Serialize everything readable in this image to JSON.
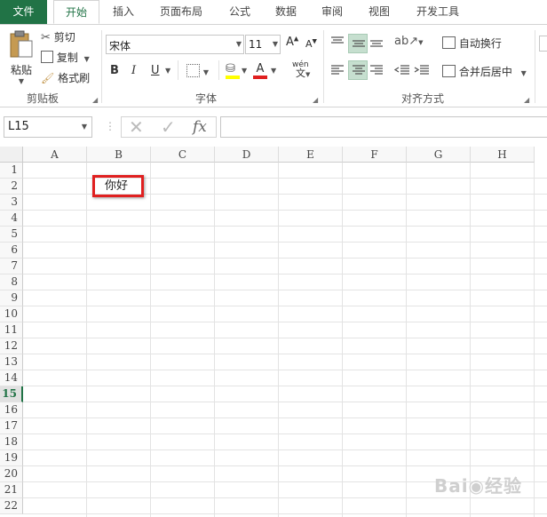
{
  "tabs": [
    "文件",
    "开始",
    "插入",
    "页面布局",
    "公式",
    "数据",
    "审阅",
    "视图",
    "开发工具"
  ],
  "clipboard": {
    "paste": "粘贴",
    "cut": "剪切",
    "copy": "复制",
    "format_painter": "格式刷",
    "group": "剪贴板"
  },
  "font": {
    "name": "宋体",
    "size": "11",
    "bold": "B",
    "italic": "I",
    "underline": "U",
    "phonetic": "wén",
    "group": "字体"
  },
  "align": {
    "wrap_text": "自动换行",
    "merge_center": "合并后居中",
    "group": "对齐方式"
  },
  "formula_bar": {
    "name_box": "L15",
    "formula": ""
  },
  "columns": [
    "A",
    "B",
    "C",
    "D",
    "E",
    "F",
    "G",
    "H"
  ],
  "rows": [
    "1",
    "2",
    "3",
    "4",
    "5",
    "6",
    "7",
    "8",
    "9",
    "10",
    "11",
    "12",
    "13",
    "14",
    "15",
    "16",
    "17",
    "18",
    "19",
    "20",
    "21",
    "22"
  ],
  "selected_row": "15",
  "cell_b2": "你好",
  "colors": {
    "accent": "#217346",
    "highlight_box": "#e02020",
    "fill_yellow": "#ffff00",
    "font_red": "#e02020"
  }
}
